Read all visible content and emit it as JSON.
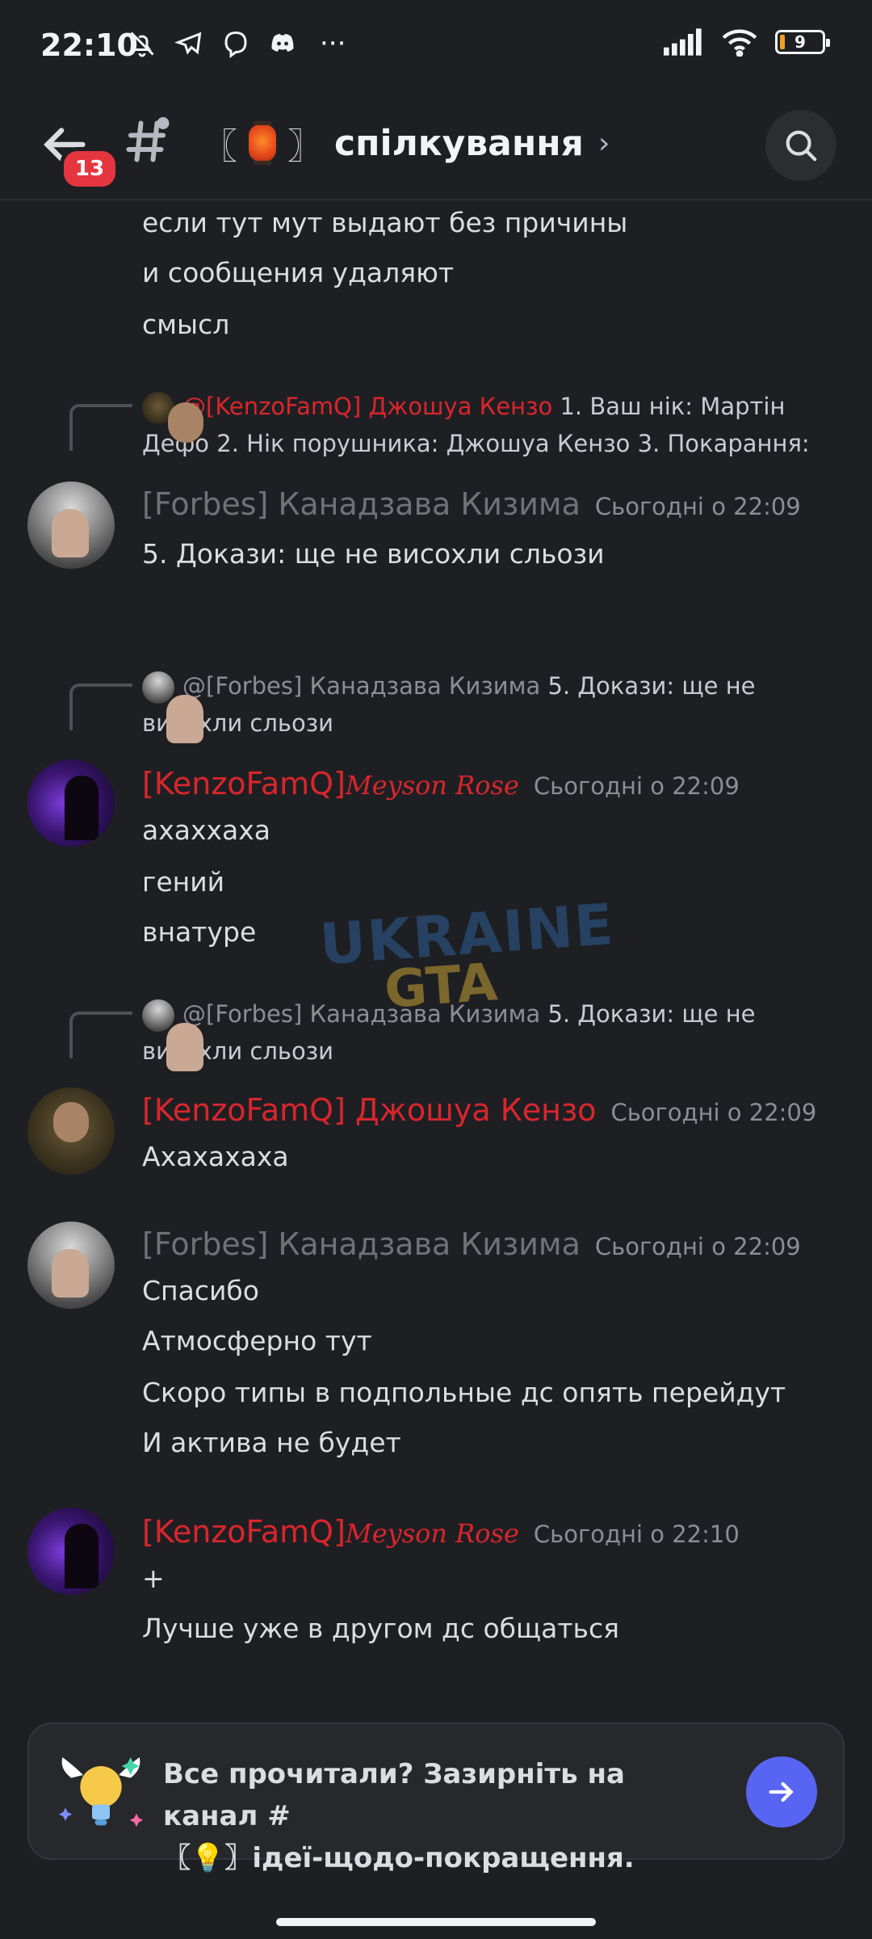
{
  "status": {
    "time": "22:10",
    "battery": "9",
    "more": "···"
  },
  "header": {
    "badge": "13",
    "channel_open": "〖",
    "channel_close": "〗",
    "channel_name": "спілкування",
    "chevron": "›"
  },
  "messages": {
    "top_lines": [
      "если тут мут выдают без причины",
      "и сообщения удаляют",
      "смысл"
    ],
    "m1": {
      "reply_mention": "@[KenzoFamQ] Джошуа Кензо",
      "reply_text_1": " 1.  Ваш нік: Мартін",
      "reply_text_2": "Дефо    2.  Нік порушника: Джошуа Кензо    3.  Покарання:",
      "author": "[Forbes] Канадзава Кизима",
      "time": "Сьогодні о 22:09",
      "lines": [
        "5.  Докази: ще не висохли сльози"
      ]
    },
    "m2": {
      "reply_mention": "@[Forbes] Канадзава Кизима",
      "reply_text_1": " 5.  Докази: ще не",
      "reply_text_2": "висохли сльози",
      "author": "[KenzoFamQ]",
      "author_script": "Meyson Rose",
      "time": "Сьогодні о 22:09",
      "lines": [
        "ахаххаха",
        "гений",
        "внатуре"
      ]
    },
    "m3": {
      "reply_mention": "@[Forbes] Канадзава Кизима",
      "reply_text_1": " 5.  Докази: ще не",
      "reply_text_2": "висохли сльози",
      "author": "[KenzoFamQ] Джошуа Кензо",
      "time": "Сьогодні о 22:09",
      "lines": [
        "Ахахахаха"
      ]
    },
    "m4": {
      "author": "[Forbes] Канадзава Кизима",
      "time": "Сьогодні о 22:09",
      "lines": [
        "Спасибо",
        "Атмосферно тут",
        "Скоро типы в подпольные дс опять перейдут",
        "И актива не будет"
      ]
    },
    "m5": {
      "author": "[KenzoFamQ]",
      "author_script": "Meyson Rose",
      "time": "Сьогодні о 22:10",
      "lines": [
        "+",
        "Лучше уже в другом дс общаться"
      ]
    }
  },
  "watermark": {
    "line1": "UKRAINE",
    "line2": "GTA"
  },
  "banner": {
    "line1": "Все прочитали? Зазирніть на канал #",
    "line2": "〖💡〗ідеї-щодо-покращення."
  },
  "colors": {
    "accent": "#5865f2",
    "mention_red": "#d9262c",
    "badge_red": "#e5363f",
    "background": "#1e1f23"
  }
}
